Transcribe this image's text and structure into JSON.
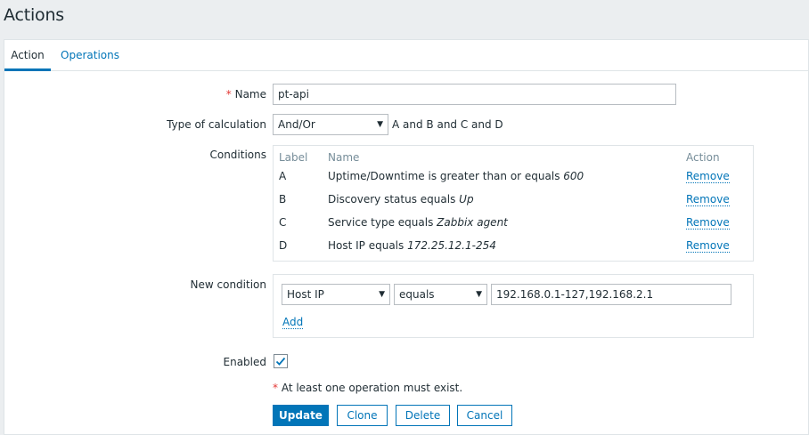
{
  "page": {
    "title": "Actions"
  },
  "tabs": [
    {
      "label": "Action"
    },
    {
      "label": "Operations"
    }
  ],
  "form": {
    "name": {
      "required_mark": "*",
      "label": "Name",
      "value": "pt-api"
    },
    "calc": {
      "label": "Type of calculation",
      "value": "And/Or",
      "expression": "A and B and C and D"
    },
    "conditions": {
      "label": "Conditions",
      "headers": {
        "label": "Label",
        "name": "Name",
        "action": "Action"
      },
      "rows": [
        {
          "label": "A",
          "text": "Uptime/Downtime is greater than or equals ",
          "value": "600",
          "action": "Remove"
        },
        {
          "label": "B",
          "text": "Discovery status equals ",
          "value": "Up",
          "action": "Remove"
        },
        {
          "label": "C",
          "text": "Service type equals ",
          "value": "Zabbix agent",
          "action": "Remove"
        },
        {
          "label": "D",
          "text": "Host IP equals ",
          "value": "172.25.12.1-254",
          "action": "Remove"
        }
      ]
    },
    "new_condition": {
      "label": "New condition",
      "type": "Host IP",
      "operator": "equals",
      "value": "192.168.0.1-127,192.168.2.1",
      "add_label": "Add"
    },
    "enabled": {
      "label": "Enabled",
      "checked": true
    },
    "warning": {
      "mark": "*",
      "text": " At least one operation must exist."
    }
  },
  "buttons": {
    "update": "Update",
    "clone": "Clone",
    "delete": "Delete",
    "cancel": "Cancel"
  },
  "colors": {
    "accent": "#0275b8",
    "required": "#e33734",
    "background": "#ebeef0"
  }
}
